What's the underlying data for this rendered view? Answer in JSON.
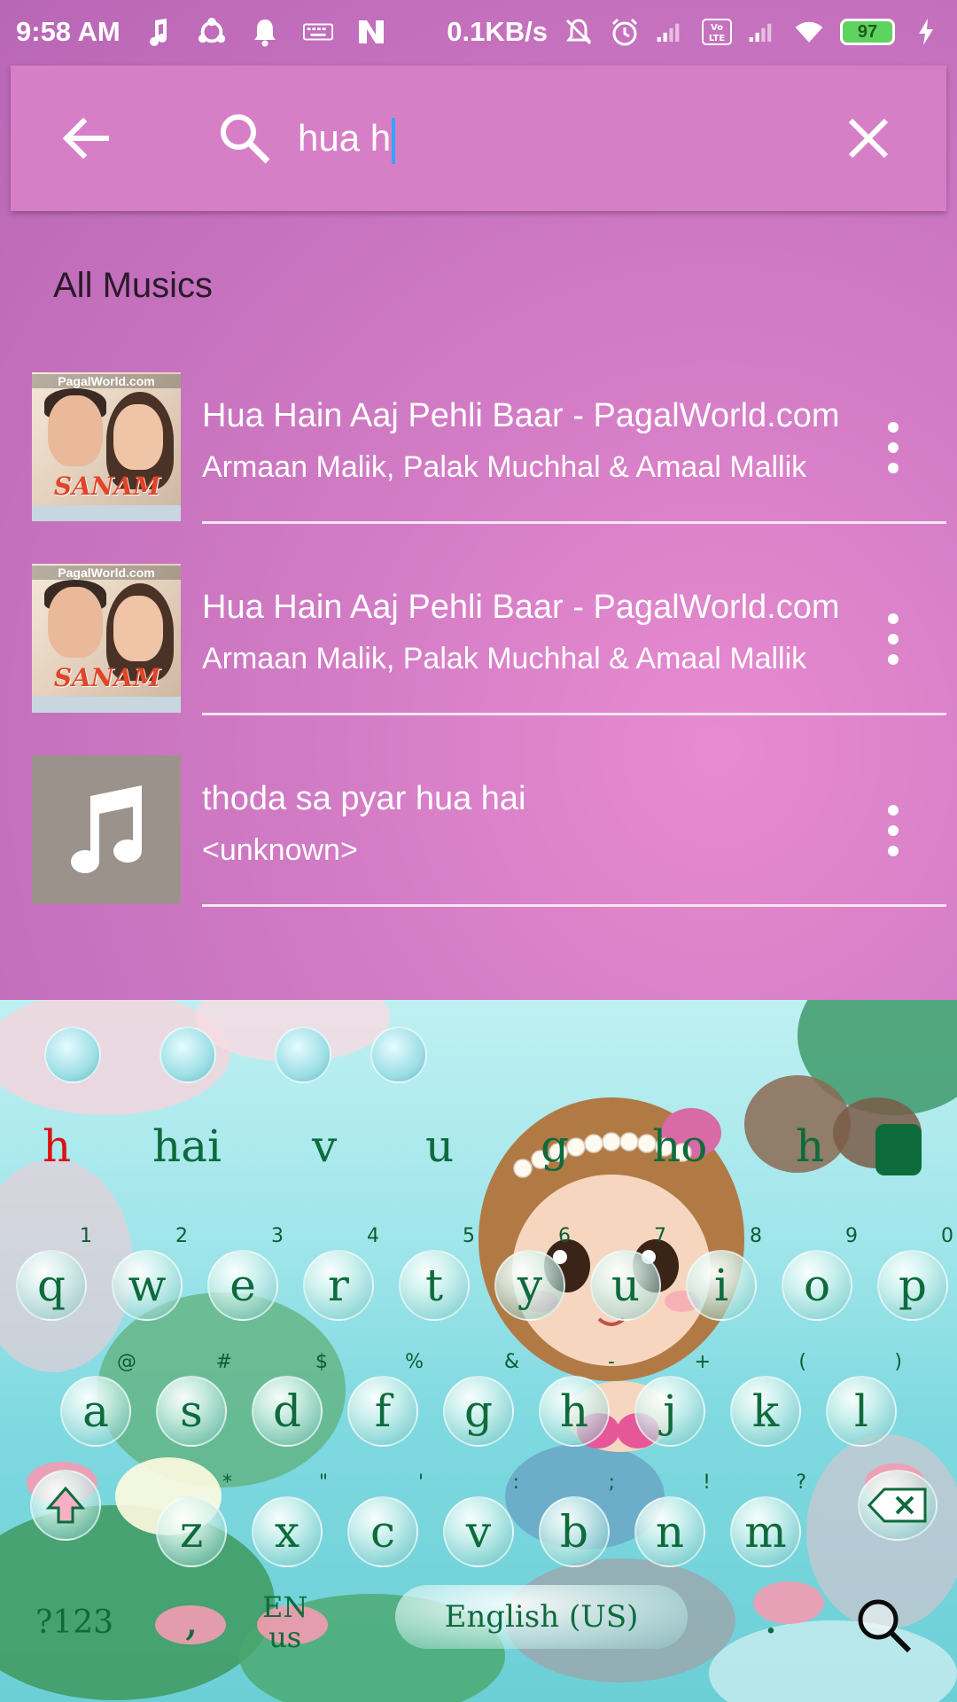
{
  "status_bar": {
    "time": "9:58 AM",
    "net_speed": "0.1KB/s",
    "battery": "97"
  },
  "search": {
    "query": "hua h",
    "back_icon": "arrow-left-icon",
    "search_icon": "magnifier-icon",
    "clear_icon": "close-x-icon"
  },
  "section": {
    "title": "All Musics"
  },
  "songs": [
    {
      "title": "Hua Hain Aaj Pehli Baar - PagalWorld.com",
      "artist": "Armaan Malik, Palak Muchhal & Amaal Mallik",
      "art": "album",
      "art_tag": "PagalWorld.com",
      "art_logo": "SANAM RE"
    },
    {
      "title": "Hua Hain Aaj Pehli Baar - PagalWorld.com",
      "artist": "Armaan Malik, Palak Muchhal & Amaal Mallik",
      "art": "album",
      "art_tag": "PagalWorld.com",
      "art_logo": "SANAM RE"
    },
    {
      "title": "thoda sa pyar hua hai",
      "artist": "<unknown>",
      "art": "music-note"
    }
  ],
  "keyboard": {
    "suggestions": [
      "h",
      "hai",
      "v",
      "u",
      "g",
      "ho",
      "h"
    ],
    "row1": [
      {
        "k": "q",
        "h": "1"
      },
      {
        "k": "w",
        "h": "2"
      },
      {
        "k": "e",
        "h": "3"
      },
      {
        "k": "r",
        "h": "4"
      },
      {
        "k": "t",
        "h": "5"
      },
      {
        "k": "y",
        "h": "6"
      },
      {
        "k": "u",
        "h": "7"
      },
      {
        "k": "i",
        "h": "8"
      },
      {
        "k": "o",
        "h": "9"
      },
      {
        "k": "p",
        "h": "0"
      }
    ],
    "row2": [
      {
        "k": "a",
        "h": "@"
      },
      {
        "k": "s",
        "h": "#"
      },
      {
        "k": "d",
        "h": "$"
      },
      {
        "k": "f",
        "h": "%"
      },
      {
        "k": "g",
        "h": "&"
      },
      {
        "k": "h",
        "h": "-"
      },
      {
        "k": "j",
        "h": "+"
      },
      {
        "k": "k",
        "h": "("
      },
      {
        "k": "l",
        "h": ")"
      }
    ],
    "row3": [
      {
        "k": "z",
        "h": "*"
      },
      {
        "k": "x",
        "h": "\""
      },
      {
        "k": "c",
        "h": "'"
      },
      {
        "k": "v",
        "h": ":"
      },
      {
        "k": "b",
        "h": ";"
      },
      {
        "k": "n",
        "h": "!"
      },
      {
        "k": "m",
        "h": "?"
      }
    ],
    "symbols_label": "?123",
    "comma_label": ",",
    "lang_label": "EN",
    "lang_sub": "us",
    "space_label": "English (US)",
    "period_label": "."
  }
}
